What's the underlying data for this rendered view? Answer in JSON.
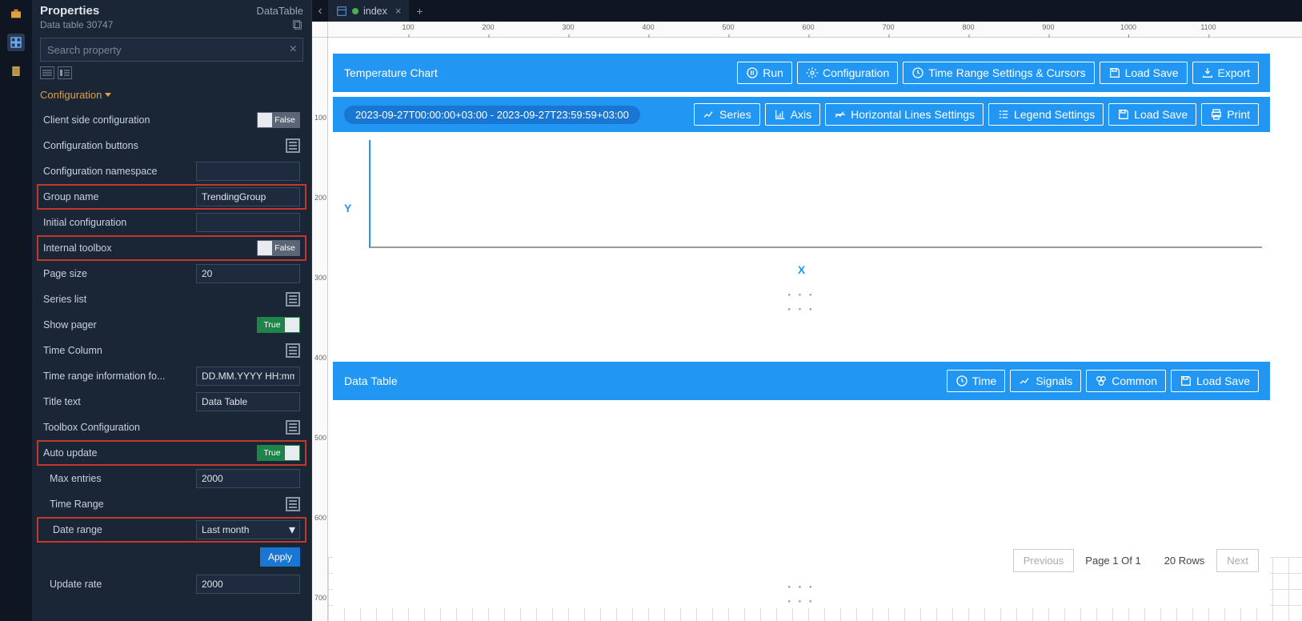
{
  "properties": {
    "title": "Properties",
    "type": "DataTable",
    "subtitle": "Data table 30747",
    "search_placeholder": "Search property",
    "section": "Configuration",
    "items": {
      "client_side_config": {
        "label": "Client side configuration",
        "value": "False"
      },
      "config_buttons": {
        "label": "Configuration buttons"
      },
      "config_namespace": {
        "label": "Configuration namespace",
        "value": ""
      },
      "group_name": {
        "label": "Group name",
        "value": "TrendingGroup"
      },
      "initial_config": {
        "label": "Initial configuration",
        "value": ""
      },
      "internal_toolbox": {
        "label": "Internal toolbox",
        "value": "False"
      },
      "page_size": {
        "label": "Page size",
        "value": "20"
      },
      "series_list": {
        "label": "Series list"
      },
      "show_pager": {
        "label": "Show pager",
        "value": "True"
      },
      "time_column": {
        "label": "Time Column"
      },
      "time_range_info": {
        "label": "Time range information fo...",
        "value": "DD.MM.YYYY HH:mm"
      },
      "title_text": {
        "label": "Title text",
        "value": "Data Table"
      },
      "toolbox_config": {
        "label": "Toolbox Configuration"
      },
      "auto_update": {
        "label": "Auto update",
        "value": "True"
      },
      "max_entries": {
        "label": "Max entries",
        "value": "2000"
      },
      "time_range": {
        "label": "Time Range"
      },
      "date_range": {
        "label": "Date range",
        "value": "Last month"
      },
      "apply": "Apply",
      "update_rate": {
        "label": "Update rate",
        "value": "2000"
      }
    }
  },
  "tabs": {
    "index": "index"
  },
  "chart": {
    "title": "Temperature Chart",
    "run": "Run",
    "configuration": "Configuration",
    "time_range_settings": "Time Range Settings & Cursors",
    "load_save": "Load Save",
    "export": "Export",
    "date_range": "2023-09-27T00:00:00+03:00 - 2023-09-27T23:59:59+03:00",
    "series": "Series",
    "axis": "Axis",
    "horiz_lines": "Horizontal Lines Settings",
    "legend": "Legend Settings",
    "print": "Print",
    "xlabel": "X",
    "ylabel": "Y"
  },
  "datatable": {
    "title": "Data Table",
    "time": "Time",
    "signals": "Signals",
    "common": "Common",
    "load_save": "Load Save",
    "previous": "Previous",
    "page_of": "Page 1 Of 1",
    "rows": "20 Rows",
    "next": "Next"
  }
}
